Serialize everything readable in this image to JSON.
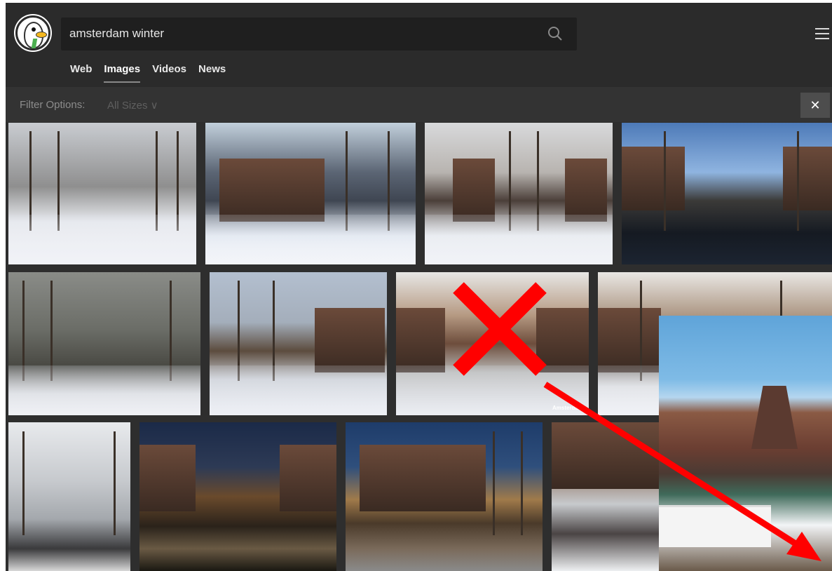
{
  "search": {
    "query": "amsterdam winter"
  },
  "tabs": [
    {
      "label": "Web",
      "active": false
    },
    {
      "label": "Images",
      "active": true
    },
    {
      "label": "Videos",
      "active": false
    },
    {
      "label": "News",
      "active": false
    }
  ],
  "filter": {
    "label": "Filter Options:",
    "size_value": "All Sizes ∨",
    "close_label": "✕"
  },
  "icons": {
    "logo": "duckduckgo-logo-icon",
    "search": "magnifier-icon",
    "menu": "hamburger-menu-icon",
    "close": "close-icon"
  },
  "colors": {
    "header_bg": "#2b2b2b",
    "filter_bg": "#333333",
    "annotation_red": "#ff0000"
  },
  "image_results": {
    "caption_watermark": "Amsterdam"
  }
}
